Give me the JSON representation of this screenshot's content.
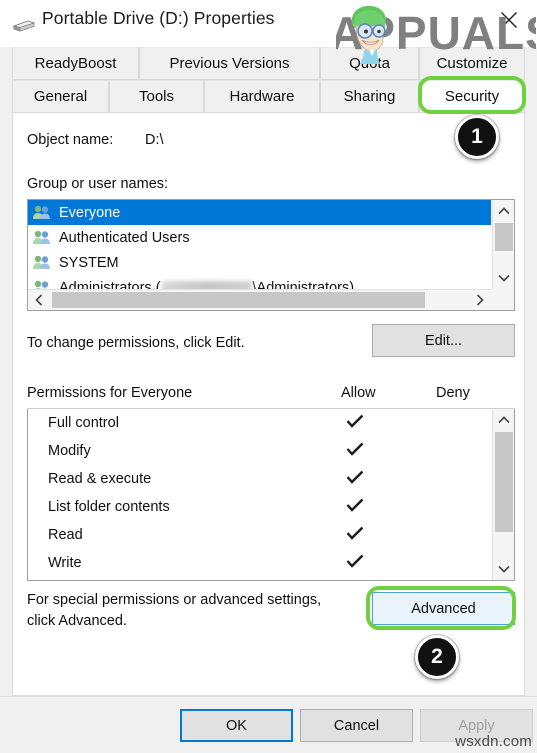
{
  "window": {
    "title": "Portable Drive (D:) Properties",
    "icon": "usb-drive-icon",
    "close_label": "✕"
  },
  "tabs": {
    "row1": [
      {
        "label": "ReadyBoost",
        "active": false
      },
      {
        "label": "Previous Versions",
        "active": false
      },
      {
        "label": "Quota",
        "active": false
      },
      {
        "label": "Customize",
        "active": false
      }
    ],
    "row2": [
      {
        "label": "General",
        "active": false
      },
      {
        "label": "Tools",
        "active": false
      },
      {
        "label": "Hardware",
        "active": false
      },
      {
        "label": "Sharing",
        "active": false
      },
      {
        "label": "Security",
        "active": true
      }
    ]
  },
  "security": {
    "object_name_label": "Object name:",
    "object_name_value": "D:\\",
    "group_label": "Group or user names:",
    "groups": [
      {
        "name": "Everyone",
        "selected": true,
        "redacted": false
      },
      {
        "name": "Authenticated Users",
        "selected": false,
        "redacted": false
      },
      {
        "name": "SYSTEM",
        "selected": false,
        "redacted": false
      },
      {
        "name": "Administrators (",
        "suffix": "\\Administrators)",
        "selected": false,
        "redacted": true
      }
    ],
    "change_hint": "To change permissions, click Edit.",
    "edit_button": "Edit...",
    "permissions_label": "Permissions for Everyone",
    "allow_header": "Allow",
    "deny_header": "Deny",
    "permissions": [
      {
        "name": "Full control",
        "allow": true,
        "deny": false
      },
      {
        "name": "Modify",
        "allow": true,
        "deny": false
      },
      {
        "name": "Read & execute",
        "allow": true,
        "deny": false
      },
      {
        "name": "List folder contents",
        "allow": true,
        "deny": false
      },
      {
        "name": "Read",
        "allow": true,
        "deny": false
      },
      {
        "name": "Write",
        "allow": true,
        "deny": false
      }
    ],
    "advanced_hint_line1": "For special permissions or advanced settings,",
    "advanced_hint_line2": "click Advanced.",
    "advanced_button": "Advanced"
  },
  "footer": {
    "ok": "OK",
    "cancel": "Cancel",
    "apply": "Apply",
    "apply_disabled": true
  },
  "annotations": {
    "highlight_color": "#6fd13f",
    "badges": [
      {
        "number": "1",
        "target": "security-tab"
      },
      {
        "number": "2",
        "target": "advanced-button"
      }
    ]
  },
  "watermarks": {
    "brand": "APPUALS",
    "site": "wsxdn.com"
  }
}
